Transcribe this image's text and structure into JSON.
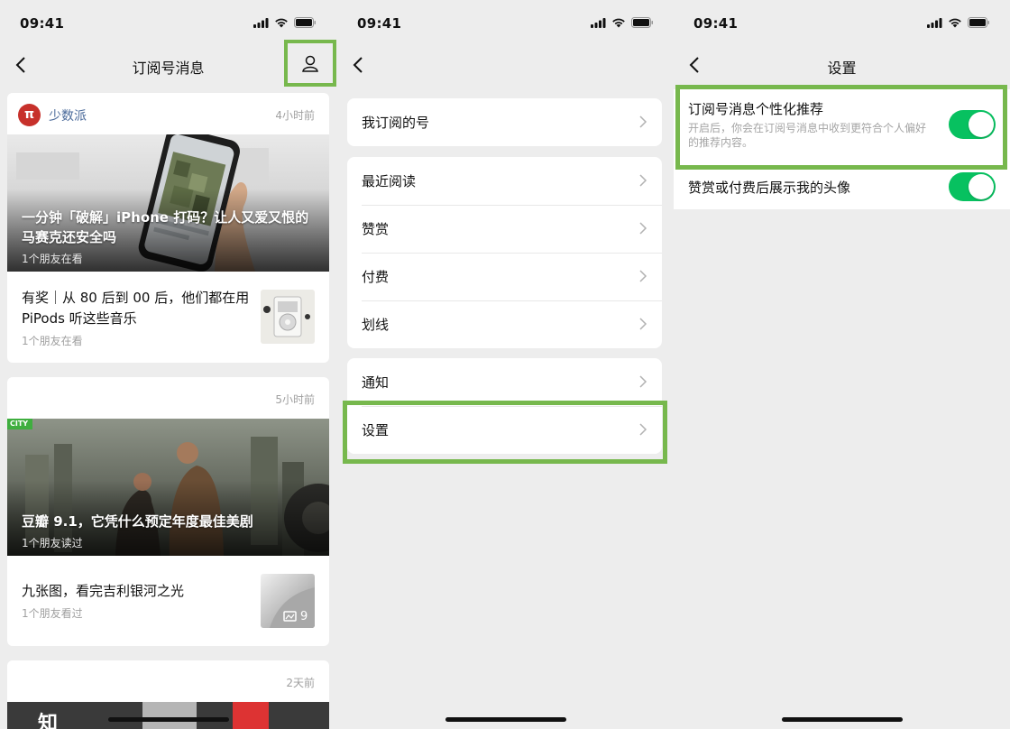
{
  "status": {
    "time": "09:41"
  },
  "screen1": {
    "title": "订阅号消息",
    "cards": [
      {
        "source": "少数派",
        "source_icon": "π",
        "time": "4小时前",
        "hero": {
          "title": "一分钟「破解」iPhone 打码？让人又爱又恨的马赛克还安全吗",
          "sub": "1个朋友在看"
        },
        "rows": [
          {
            "title": "有奖｜从 80 后到 00 后，他们都在用 PiPods 听这些音乐",
            "sub": "1个朋友在看"
          }
        ]
      },
      {
        "time": "5小时前",
        "hero": {
          "badge": "CITY",
          "title": "豆瓣 9.1，它凭什么预定年度最佳美剧",
          "sub": "1个朋友读过"
        },
        "rows": [
          {
            "title": "九张图，看完吉利银河之光",
            "sub": "1个朋友看过",
            "thumb_count": "9"
          }
        ]
      },
      {
        "time": "2天前",
        "hero_char": "知"
      }
    ]
  },
  "screen2": {
    "groups": [
      [
        "我订阅的号"
      ],
      [
        "最近阅读",
        "赞赏",
        "付费",
        "划线"
      ],
      [
        "通知",
        "设置"
      ]
    ]
  },
  "screen3": {
    "title": "设置",
    "items": [
      {
        "title": "订阅号消息个性化推荐",
        "desc": "开启后，你会在订阅号消息中收到更符合个人偏好的推荐内容。",
        "on": true
      },
      {
        "title": "赞赏或付费后展示我的头像",
        "on": true
      }
    ]
  },
  "colors": {
    "highlight": "#77b84d",
    "toggle_on": "#07c160",
    "source_red": "#c7312b",
    "source_blue": "#4a6a9a"
  }
}
